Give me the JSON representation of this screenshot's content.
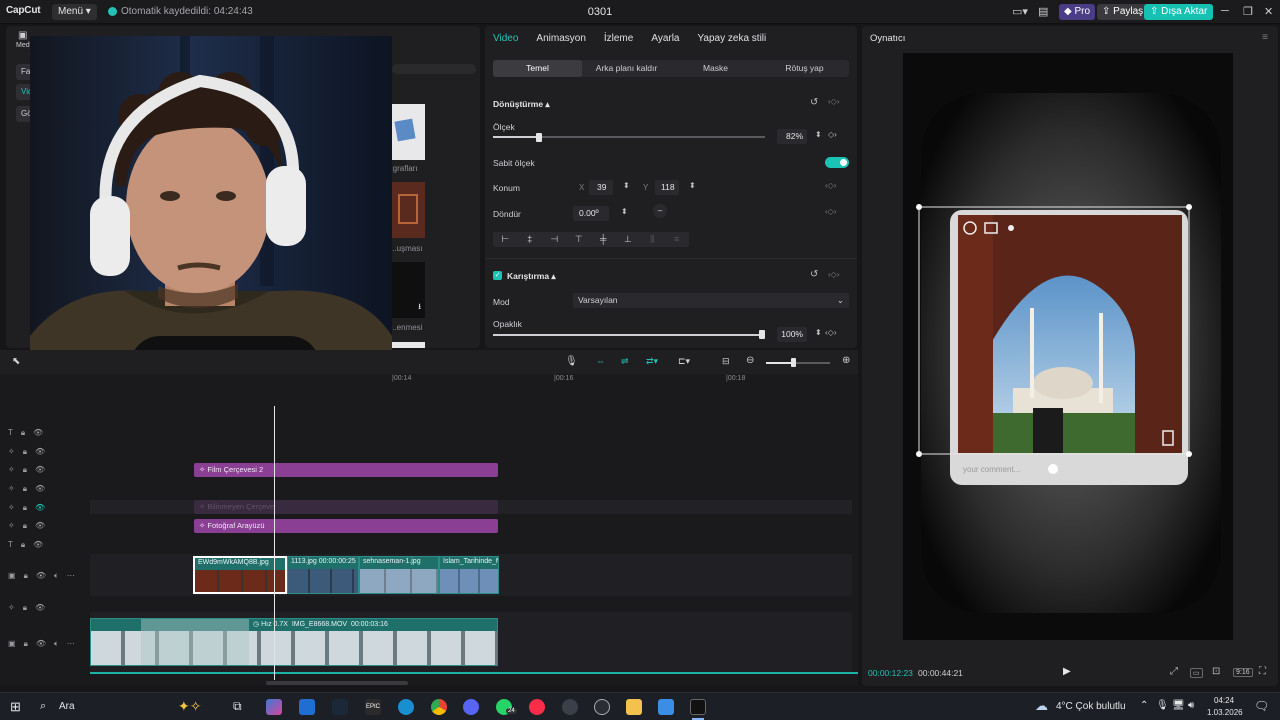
{
  "app": {
    "logo": "CapCut",
    "menu_label": "Menü",
    "autosave_text": "Otomatik kaydedildi: 04:24:43",
    "project_title": "0301",
    "pro_label": "Pro",
    "share_label": "Paylaş",
    "export_label": "Dışa Aktar"
  },
  "left_panel": {
    "media_tab": "Medya",
    "side_items": [
      "Fave",
      "Vide",
      "Göv"
    ],
    "thumb_labels": [
      "...grafları",
      "...uşması",
      "...enmesi"
    ]
  },
  "properties": {
    "tabs": [
      "Video",
      "Animasyon",
      "İzleme",
      "Ayarla",
      "Yapay zeka stili"
    ],
    "subtabs": [
      "Temel",
      "Arka planı kaldır",
      "Maske",
      "Rötuş yap"
    ],
    "transform_header": "Dönüştürme",
    "scale_label": "Ölçek",
    "scale_value": "82%",
    "scale_fraction": 0.17,
    "uniform_scale_label": "Sabit ölçek",
    "position_label": "Konum",
    "x_label": "X",
    "x_value": "39",
    "y_label": "Y",
    "y_value": "118",
    "rotate_label": "Döndür",
    "rotate_value": "0.00º",
    "blend_header": "Karıştırma",
    "mode_label": "Mod",
    "mode_value": "Varsayılan",
    "opacity_label": "Opaklık",
    "opacity_value": "100%",
    "opacity_fraction": 1.0
  },
  "player": {
    "title": "Oynatıcı",
    "comment_placeholder": "your comment...",
    "current_time": "00:00:12:23",
    "total_time": "00:00:44:21",
    "ratio_label": "9:16"
  },
  "timeline": {
    "ruler_ticks": [
      "|00:14",
      "|00:16",
      "|00:18"
    ],
    "tracks": {
      "film_frame": "Film Çerçevesi 2",
      "hidden_overlay": "Bilinmeyen Çerçeve",
      "ui_overlay": "Fotoğraf Arayüzü"
    },
    "main_clips": [
      {
        "label": "EWd9mWkAMQ8B.jpg"
      },
      {
        "label": "1113.jpg"
      },
      {
        "label": "00:00:00:25"
      },
      {
        "label": "sehnaseman-1.jpg"
      },
      {
        "label": "İslam_Tarihinde_Mu"
      }
    ],
    "bottom_clip": {
      "speed": "Hız 0.7X",
      "name": "IMG_E8668.MOV",
      "duration": "00:00:03:16"
    }
  },
  "taskbar": {
    "search_label": "Ara",
    "weather": "4°C  Çok bulutlu",
    "time": "04:24",
    "date": "1.03.2026",
    "whatsapp_badge": "24"
  }
}
